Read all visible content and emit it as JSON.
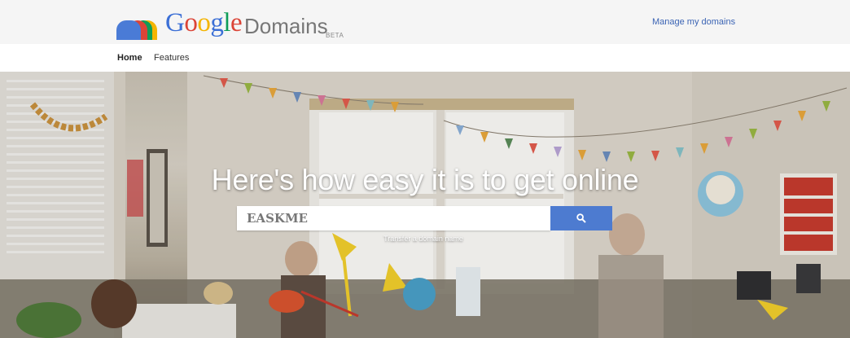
{
  "header": {
    "logo_letters": [
      {
        "char": "G",
        "color": "#3b6fd6"
      },
      {
        "char": "o",
        "color": "#db4437"
      },
      {
        "char": "o",
        "color": "#f4b400"
      },
      {
        "char": "g",
        "color": "#3b6fd6"
      },
      {
        "char": "l",
        "color": "#0f9d58"
      },
      {
        "char": "e",
        "color": "#db4437"
      }
    ],
    "product_name": "Domains",
    "badge": "BETA",
    "manage_link": "Manage my domains"
  },
  "nav": {
    "items": [
      {
        "label": "Home",
        "active": true
      },
      {
        "label": "Features",
        "active": false
      }
    ]
  },
  "hero": {
    "headline": "Here's how easy it is to get online",
    "search": {
      "value": "EASKME",
      "placeholder": ""
    },
    "search_button_icon": "search-icon",
    "transfer_link": "Transfer a domain name"
  },
  "colors": {
    "brand_blue": "#4d7bd0",
    "link_blue": "#3b64b4",
    "header_bg": "#f5f5f5"
  }
}
